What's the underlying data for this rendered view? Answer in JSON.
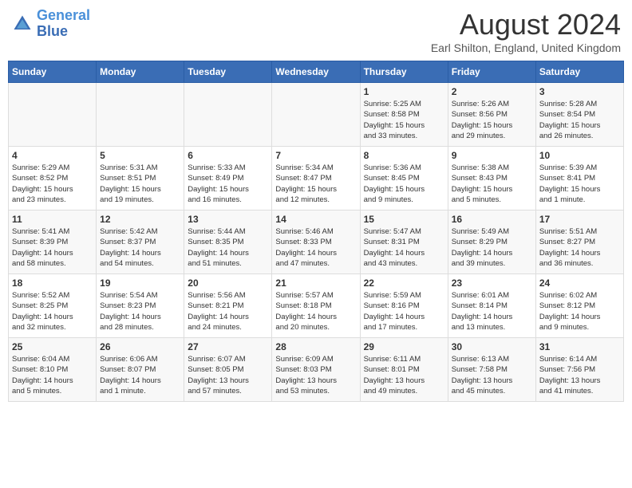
{
  "header": {
    "logo_line1": "General",
    "logo_line2": "Blue",
    "month": "August 2024",
    "location": "Earl Shilton, England, United Kingdom"
  },
  "days_of_week": [
    "Sunday",
    "Monday",
    "Tuesday",
    "Wednesday",
    "Thursday",
    "Friday",
    "Saturday"
  ],
  "weeks": [
    [
      {
        "day": "",
        "info": ""
      },
      {
        "day": "",
        "info": ""
      },
      {
        "day": "",
        "info": ""
      },
      {
        "day": "",
        "info": ""
      },
      {
        "day": "1",
        "info": "Sunrise: 5:25 AM\nSunset: 8:58 PM\nDaylight: 15 hours\nand 33 minutes."
      },
      {
        "day": "2",
        "info": "Sunrise: 5:26 AM\nSunset: 8:56 PM\nDaylight: 15 hours\nand 29 minutes."
      },
      {
        "day": "3",
        "info": "Sunrise: 5:28 AM\nSunset: 8:54 PM\nDaylight: 15 hours\nand 26 minutes."
      }
    ],
    [
      {
        "day": "4",
        "info": "Sunrise: 5:29 AM\nSunset: 8:52 PM\nDaylight: 15 hours\nand 23 minutes."
      },
      {
        "day": "5",
        "info": "Sunrise: 5:31 AM\nSunset: 8:51 PM\nDaylight: 15 hours\nand 19 minutes."
      },
      {
        "day": "6",
        "info": "Sunrise: 5:33 AM\nSunset: 8:49 PM\nDaylight: 15 hours\nand 16 minutes."
      },
      {
        "day": "7",
        "info": "Sunrise: 5:34 AM\nSunset: 8:47 PM\nDaylight: 15 hours\nand 12 minutes."
      },
      {
        "day": "8",
        "info": "Sunrise: 5:36 AM\nSunset: 8:45 PM\nDaylight: 15 hours\nand 9 minutes."
      },
      {
        "day": "9",
        "info": "Sunrise: 5:38 AM\nSunset: 8:43 PM\nDaylight: 15 hours\nand 5 minutes."
      },
      {
        "day": "10",
        "info": "Sunrise: 5:39 AM\nSunset: 8:41 PM\nDaylight: 15 hours\nand 1 minute."
      }
    ],
    [
      {
        "day": "11",
        "info": "Sunrise: 5:41 AM\nSunset: 8:39 PM\nDaylight: 14 hours\nand 58 minutes."
      },
      {
        "day": "12",
        "info": "Sunrise: 5:42 AM\nSunset: 8:37 PM\nDaylight: 14 hours\nand 54 minutes."
      },
      {
        "day": "13",
        "info": "Sunrise: 5:44 AM\nSunset: 8:35 PM\nDaylight: 14 hours\nand 51 minutes."
      },
      {
        "day": "14",
        "info": "Sunrise: 5:46 AM\nSunset: 8:33 PM\nDaylight: 14 hours\nand 47 minutes."
      },
      {
        "day": "15",
        "info": "Sunrise: 5:47 AM\nSunset: 8:31 PM\nDaylight: 14 hours\nand 43 minutes."
      },
      {
        "day": "16",
        "info": "Sunrise: 5:49 AM\nSunset: 8:29 PM\nDaylight: 14 hours\nand 39 minutes."
      },
      {
        "day": "17",
        "info": "Sunrise: 5:51 AM\nSunset: 8:27 PM\nDaylight: 14 hours\nand 36 minutes."
      }
    ],
    [
      {
        "day": "18",
        "info": "Sunrise: 5:52 AM\nSunset: 8:25 PM\nDaylight: 14 hours\nand 32 minutes."
      },
      {
        "day": "19",
        "info": "Sunrise: 5:54 AM\nSunset: 8:23 PM\nDaylight: 14 hours\nand 28 minutes."
      },
      {
        "day": "20",
        "info": "Sunrise: 5:56 AM\nSunset: 8:21 PM\nDaylight: 14 hours\nand 24 minutes."
      },
      {
        "day": "21",
        "info": "Sunrise: 5:57 AM\nSunset: 8:18 PM\nDaylight: 14 hours\nand 20 minutes."
      },
      {
        "day": "22",
        "info": "Sunrise: 5:59 AM\nSunset: 8:16 PM\nDaylight: 14 hours\nand 17 minutes."
      },
      {
        "day": "23",
        "info": "Sunrise: 6:01 AM\nSunset: 8:14 PM\nDaylight: 14 hours\nand 13 minutes."
      },
      {
        "day": "24",
        "info": "Sunrise: 6:02 AM\nSunset: 8:12 PM\nDaylight: 14 hours\nand 9 minutes."
      }
    ],
    [
      {
        "day": "25",
        "info": "Sunrise: 6:04 AM\nSunset: 8:10 PM\nDaylight: 14 hours\nand 5 minutes."
      },
      {
        "day": "26",
        "info": "Sunrise: 6:06 AM\nSunset: 8:07 PM\nDaylight: 14 hours\nand 1 minute."
      },
      {
        "day": "27",
        "info": "Sunrise: 6:07 AM\nSunset: 8:05 PM\nDaylight: 13 hours\nand 57 minutes."
      },
      {
        "day": "28",
        "info": "Sunrise: 6:09 AM\nSunset: 8:03 PM\nDaylight: 13 hours\nand 53 minutes."
      },
      {
        "day": "29",
        "info": "Sunrise: 6:11 AM\nSunset: 8:01 PM\nDaylight: 13 hours\nand 49 minutes."
      },
      {
        "day": "30",
        "info": "Sunrise: 6:13 AM\nSunset: 7:58 PM\nDaylight: 13 hours\nand 45 minutes."
      },
      {
        "day": "31",
        "info": "Sunrise: 6:14 AM\nSunset: 7:56 PM\nDaylight: 13 hours\nand 41 minutes."
      }
    ]
  ]
}
